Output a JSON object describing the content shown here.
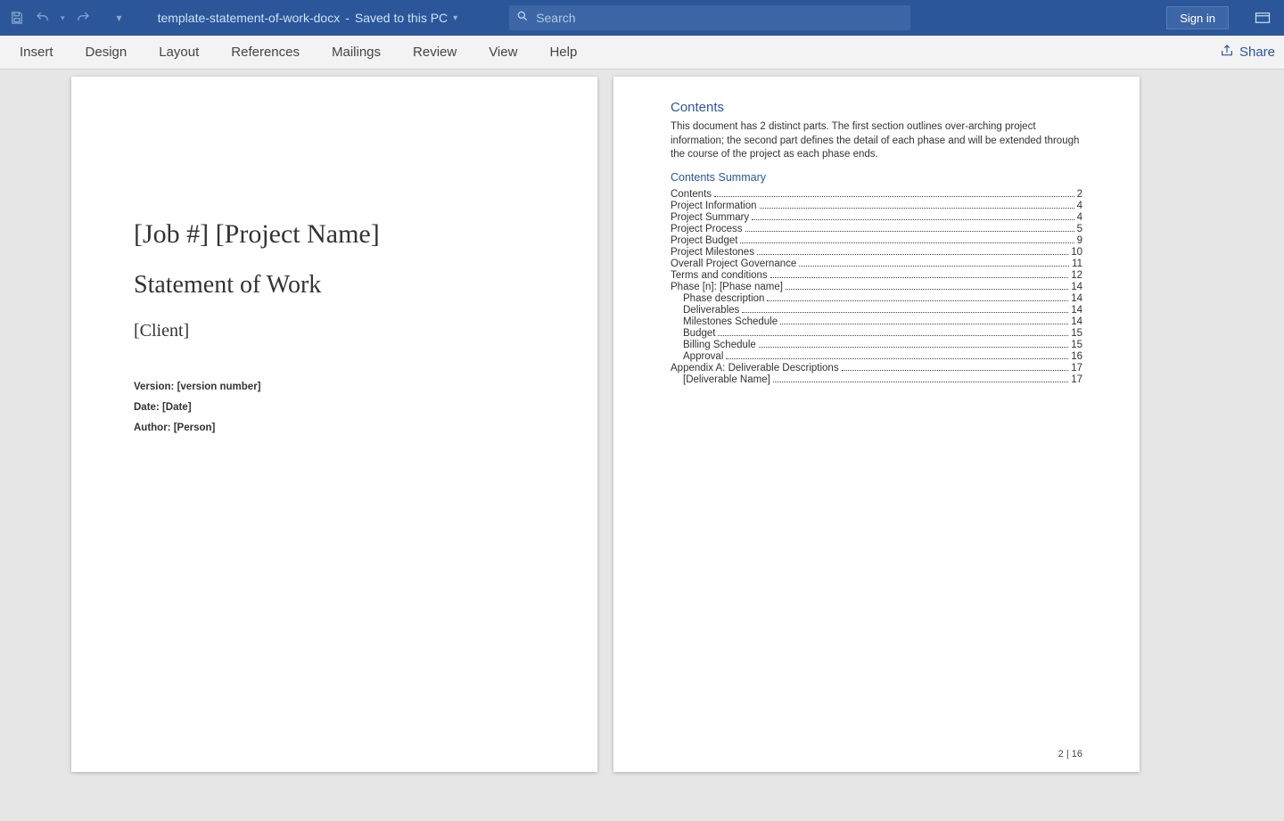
{
  "titlebar": {
    "doc_name": "template-statement-of-work-docx",
    "save_status": "Saved to this PC",
    "search_placeholder": "Search",
    "signin_label": "Sign in"
  },
  "tabs": [
    "Insert",
    "Design",
    "Layout",
    "References",
    "Mailings",
    "Review",
    "View",
    "Help"
  ],
  "share_label": "Share",
  "page1": {
    "title_line": "[Job #] [Project Name]",
    "subtitle": "Statement of Work",
    "client": "[Client]",
    "version": "Version: [version number]",
    "date": "Date: [Date]",
    "author": "Author: [Person]"
  },
  "page2": {
    "heading": "Contents",
    "intro": "This document has 2 distinct parts. The first section outlines over-arching project information; the second part defines the detail of each phase and will be extended through the course of the project as each phase ends.",
    "summary_heading": "Contents Summary",
    "toc": [
      {
        "label": "Contents",
        "page": "2",
        "indent": 0
      },
      {
        "label": "Project Information",
        "page": "4",
        "indent": 0
      },
      {
        "label": "Project Summary",
        "page": "4",
        "indent": 0
      },
      {
        "label": "Project Process",
        "page": "5",
        "indent": 0
      },
      {
        "label": "Project Budget",
        "page": "9",
        "indent": 0
      },
      {
        "label": "Project Milestones",
        "page": "10",
        "indent": 0
      },
      {
        "label": "Overall Project Governance",
        "page": "11",
        "indent": 0
      },
      {
        "label": "Terms and conditions",
        "page": "12",
        "indent": 0
      },
      {
        "label": "Phase [n]:  [Phase name]",
        "page": "14",
        "indent": 0
      },
      {
        "label": "Phase description",
        "page": "14",
        "indent": 1
      },
      {
        "label": "Deliverables",
        "page": "14",
        "indent": 1
      },
      {
        "label": "Milestones Schedule",
        "page": "14",
        "indent": 1
      },
      {
        "label": "Budget",
        "page": "15",
        "indent": 1
      },
      {
        "label": "Billing Schedule",
        "page": "15",
        "indent": 1
      },
      {
        "label": "Approval",
        "page": "16",
        "indent": 1
      },
      {
        "label": "Appendix A: Deliverable Descriptions",
        "page": "17",
        "indent": 0
      },
      {
        "label": "[Deliverable Name]",
        "page": "17",
        "indent": 1
      }
    ],
    "page_number": "2 | 16"
  }
}
